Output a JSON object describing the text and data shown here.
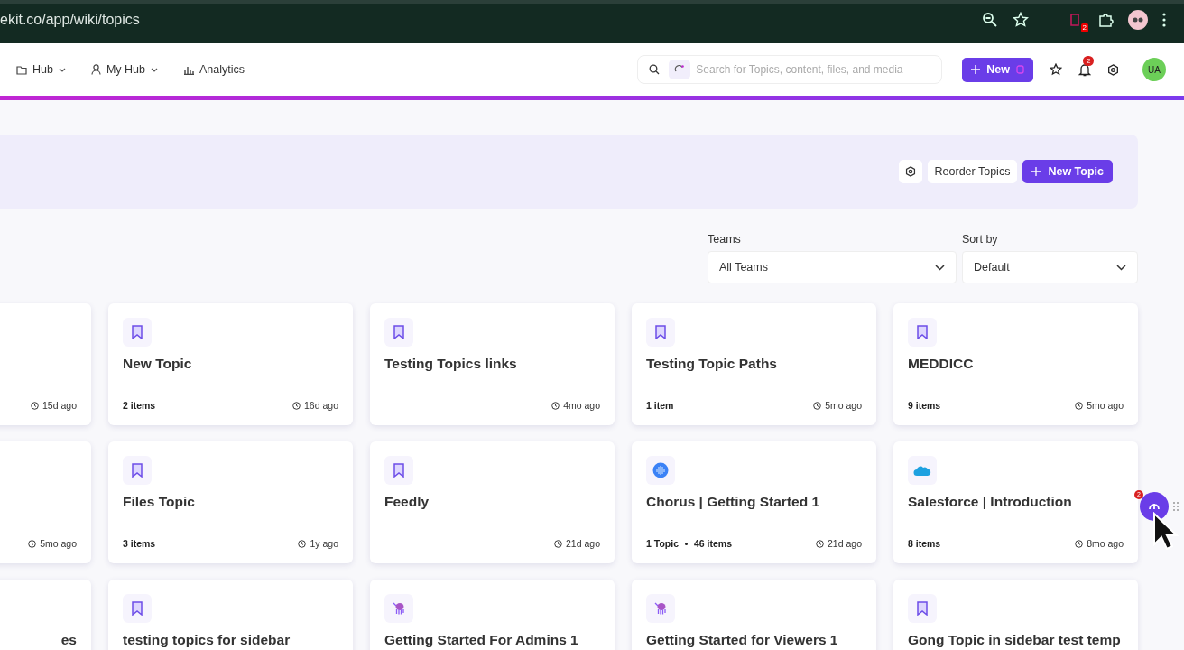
{
  "browser": {
    "url": "ekit.co/app/wiki/topics",
    "extension_badge": "2"
  },
  "nav": {
    "items": [
      {
        "label": "Hub",
        "kind": "folder",
        "dropdown": true
      },
      {
        "label": "My Hub",
        "kind": "person",
        "dropdown": true
      },
      {
        "label": "Analytics",
        "kind": "chart",
        "dropdown": false
      }
    ],
    "search": {
      "placeholder": "Search for Topics, content, files, and media"
    },
    "new_button": {
      "label": "New"
    },
    "notifications_badge": "2",
    "avatar": "UA"
  },
  "toolbar": {
    "reorder": "Reorder Topics",
    "new_topic": "New Topic"
  },
  "filters": [
    {
      "label": "Teams",
      "value": "All Teams"
    },
    {
      "label": "Sort by",
      "value": "Default"
    }
  ],
  "cards": [
    {
      "time": "15d ago"
    },
    {
      "kind": "bookmark",
      "title": "New Topic",
      "count": "2 items",
      "time": "16d ago"
    },
    {
      "kind": "bookmark",
      "title": "Testing Topics links",
      "time": "4mo ago"
    },
    {
      "kind": "bookmark",
      "title": "Testing Topic Paths",
      "count": "1 item",
      "time": "5mo ago"
    },
    {
      "kind": "bookmark",
      "title": "MEDDICC",
      "count": "9 items",
      "time": "5mo ago"
    },
    {
      "time": "5mo ago"
    },
    {
      "kind": "bookmark",
      "title": "Files Topic",
      "count": "3 items",
      "time": "1y ago"
    },
    {
      "kind": "bookmark",
      "title": "Feedly",
      "time": "21d ago"
    },
    {
      "kind": "waveform",
      "title": "Chorus | Getting Started 1",
      "topics": "1 Topic",
      "count": "46 items",
      "time": "21d ago"
    },
    {
      "kind": "cloud",
      "title": "Salesforce | Introduction",
      "count": "8 items",
      "time": "8mo ago"
    },
    {
      "title": "es"
    },
    {
      "kind": "bookmark",
      "title": "testing topics for sidebar"
    },
    {
      "kind": "octopus",
      "title": "Getting Started For Admins 1"
    },
    {
      "kind": "octopus",
      "title": "Getting Started for Viewers 1"
    },
    {
      "kind": "bookmark",
      "title": "Gong Topic in sidebar test temp"
    }
  ],
  "assistant_badge": "2"
}
